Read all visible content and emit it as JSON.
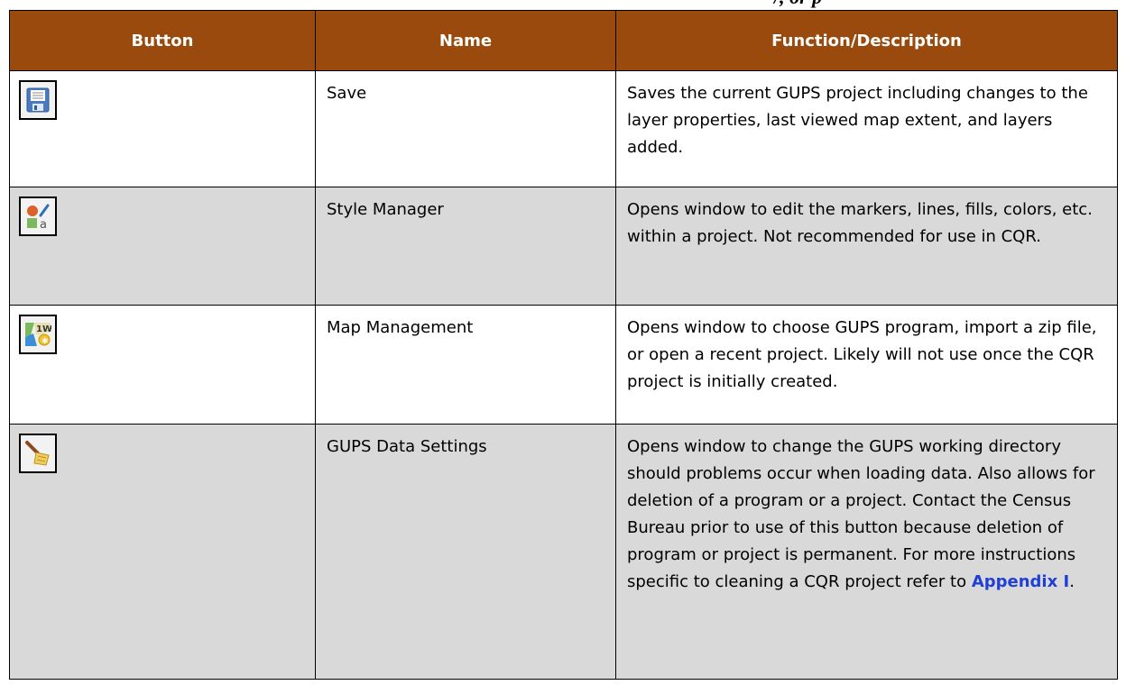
{
  "caption_tail": "/, or p",
  "table": {
    "headers": [
      "Button",
      "Name",
      "Function/Description"
    ],
    "rows": [
      {
        "icon": "save-icon",
        "name": "Save",
        "description": "Saves the current GUPS project including changes to the layer properties, last viewed map extent, and layers added."
      },
      {
        "icon": "style-manager-icon",
        "name": "Style Manager",
        "description": "Opens window to edit the markers, lines, fills, colors, etc. within a project. Not recommended for use in CQR."
      },
      {
        "icon": "map-management-icon",
        "name": "Map Management",
        "description": "Opens window to choose GUPS program, import a zip file, or open a recent project. Likely will not use once the CQR project is initially created."
      },
      {
        "icon": "gups-data-settings-icon",
        "name": "GUPS Data Settings",
        "description": "Opens window to change the GUPS working directory should problems occur when loading data. Also allows for deletion of a program or a project. Contact the Census Bureau prior to use of this button because deletion of program or project is permanent. For more instructions specific to cleaning a CQR project refer to",
        "link_text": "Appendix I",
        "description_end": "."
      }
    ]
  },
  "colors": {
    "header_bg": "#9a4a0c",
    "header_text": "#ffffff",
    "shaded_row": "#d9d9d9",
    "link": "#1f3fd6"
  }
}
